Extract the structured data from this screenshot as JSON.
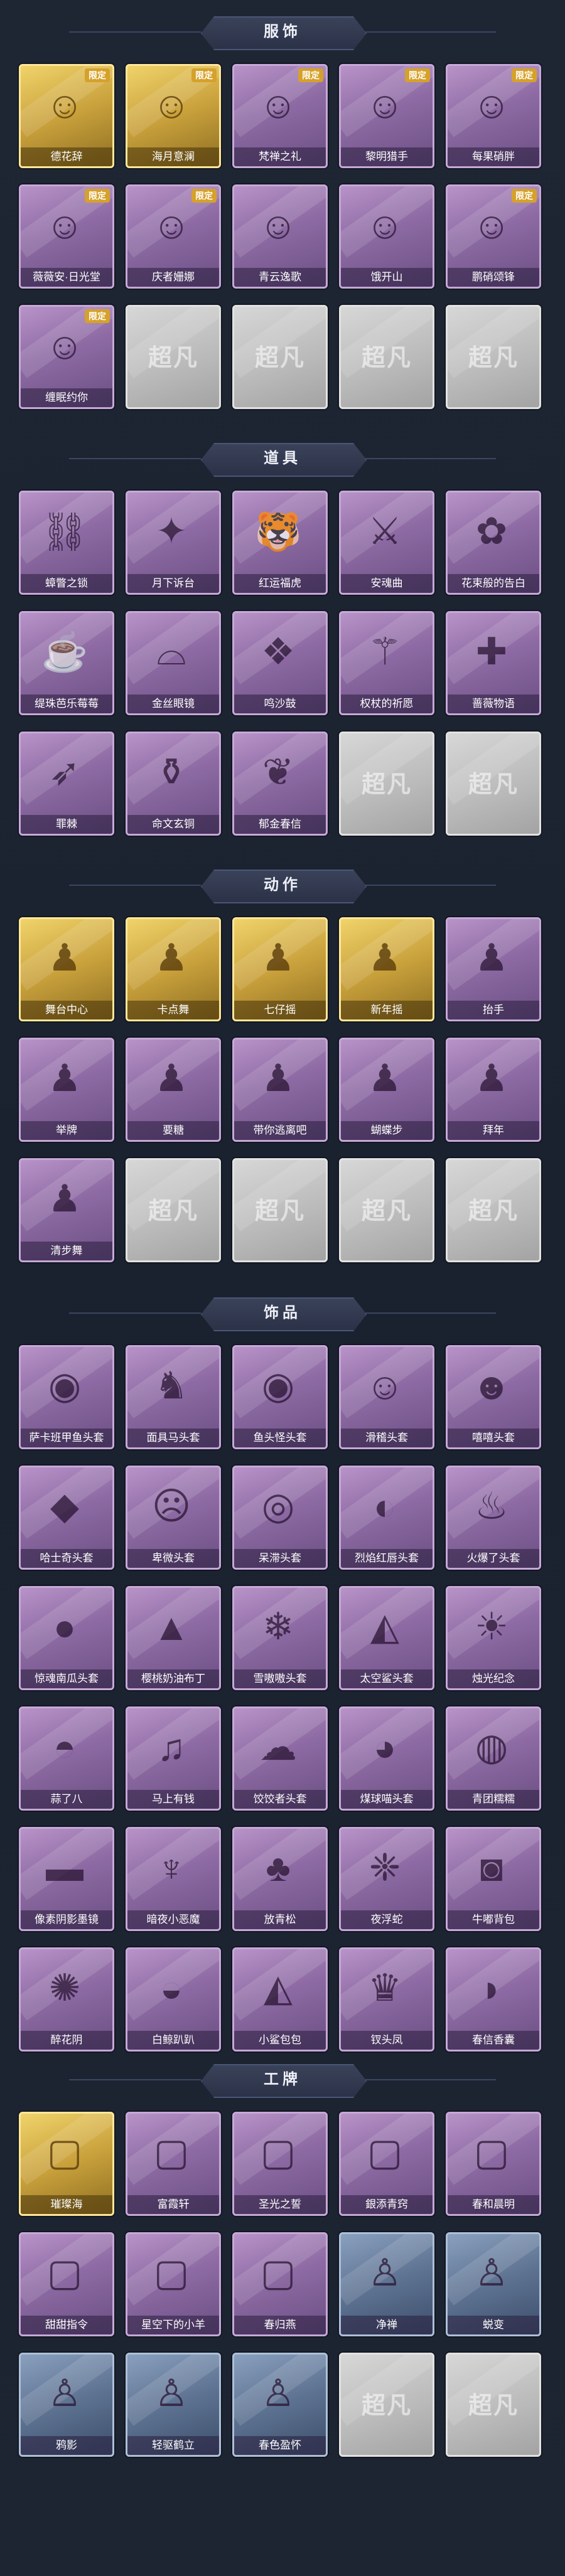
{
  "sections": [
    {
      "title": "服饰",
      "items": [
        {
          "name": "德花辞",
          "tone": "gold",
          "badge": "限定",
          "icon": "person-icon"
        },
        {
          "name": "海月意澜",
          "tone": "gold",
          "badge": "限定",
          "icon": "person-icon"
        },
        {
          "name": "梵禅之礼",
          "tone": "purple",
          "badge": "限定",
          "icon": "person-icon"
        },
        {
          "name": "黎明猎手",
          "tone": "purple",
          "badge": "限定",
          "icon": "person-icon"
        },
        {
          "name": "每果硝胖",
          "tone": "purple",
          "badge": "限定",
          "icon": "person-icon"
        },
        {
          "name": "薇薇安·日光堂",
          "tone": "purple",
          "badge": "限定",
          "icon": "person-icon"
        },
        {
          "name": "庆者姗娜",
          "tone": "purple",
          "badge": "限定",
          "icon": "person-icon"
        },
        {
          "name": "青云逸歌",
          "tone": "purple",
          "badge": "",
          "icon": "person-icon"
        },
        {
          "name": "饿开山",
          "tone": "purple",
          "badge": "",
          "icon": "person-icon"
        },
        {
          "name": "鹏硝颂锋",
          "tone": "purple",
          "badge": "限定",
          "icon": "person-icon"
        },
        {
          "name": "缠眠约你",
          "tone": "purple",
          "badge": "限定",
          "icon": "person-icon"
        },
        {
          "name": "",
          "tone": "empty",
          "badge": "",
          "icon": ""
        },
        {
          "name": "",
          "tone": "empty",
          "badge": "",
          "icon": ""
        },
        {
          "name": "",
          "tone": "empty",
          "badge": "",
          "icon": ""
        },
        {
          "name": "",
          "tone": "empty",
          "badge": "",
          "icon": ""
        }
      ]
    },
    {
      "title": "道具",
      "items": [
        {
          "name": "蟑瞥之锁",
          "tone": "purple",
          "badge": "",
          "icon": "chain-icon"
        },
        {
          "name": "月下诉台",
          "tone": "purple",
          "badge": "",
          "icon": "wand-icon"
        },
        {
          "name": "红运福虎",
          "tone": "purple",
          "badge": "",
          "icon": "tiger-icon"
        },
        {
          "name": "安魂曲",
          "tone": "purple",
          "badge": "",
          "icon": "sword-icon"
        },
        {
          "name": "花束般的告白",
          "tone": "purple",
          "badge": "",
          "icon": "rose-icon"
        },
        {
          "name": "缇珠芭乐莓莓",
          "tone": "purple",
          "badge": "",
          "icon": "drink-icon"
        },
        {
          "name": "金丝眼镜",
          "tone": "purple",
          "badge": "",
          "icon": "glasses-icon"
        },
        {
          "name": "鸣沙鼓",
          "tone": "purple",
          "badge": "",
          "icon": "lantern-icon"
        },
        {
          "name": "权杖的祈愿",
          "tone": "purple",
          "badge": "",
          "icon": "scepter-icon"
        },
        {
          "name": "蔷薇物语",
          "tone": "purple",
          "badge": "",
          "icon": "medkit-icon"
        },
        {
          "name": "罪棘",
          "tone": "purple",
          "badge": "",
          "icon": "spear-icon"
        },
        {
          "name": "命文玄铜",
          "tone": "purple",
          "badge": "",
          "icon": "bottle-icon"
        },
        {
          "name": "郁金春信",
          "tone": "purple",
          "badge": "",
          "icon": "scroll-icon"
        },
        {
          "name": "",
          "tone": "empty",
          "badge": "",
          "icon": ""
        },
        {
          "name": "",
          "tone": "empty",
          "badge": "",
          "icon": ""
        }
      ]
    },
    {
      "title": "动作",
      "items": [
        {
          "name": "舞台中心",
          "tone": "gold",
          "badge": "",
          "icon": "pose-icon"
        },
        {
          "name": "卡点舞",
          "tone": "gold",
          "badge": "",
          "icon": "pose-icon"
        },
        {
          "name": "七仔摇",
          "tone": "gold",
          "badge": "",
          "icon": "pose-icon"
        },
        {
          "name": "新年摇",
          "tone": "gold",
          "badge": "",
          "icon": "pose-icon"
        },
        {
          "name": "抬手",
          "tone": "purple",
          "badge": "",
          "icon": "pose-icon"
        },
        {
          "name": "举牌",
          "tone": "purple",
          "badge": "",
          "icon": "pose-icon"
        },
        {
          "name": "要糖",
          "tone": "purple",
          "badge": "",
          "icon": "pose-icon"
        },
        {
          "name": "带你逃离吧",
          "tone": "purple",
          "badge": "",
          "icon": "pose-icon"
        },
        {
          "name": "蝴蝶步",
          "tone": "purple",
          "badge": "",
          "icon": "pose-icon"
        },
        {
          "name": "拜年",
          "tone": "purple",
          "badge": "",
          "icon": "pose-icon"
        },
        {
          "name": "清步舞",
          "tone": "purple",
          "badge": "",
          "icon": "pose-icon"
        },
        {
          "name": "",
          "tone": "empty",
          "badge": "",
          "icon": ""
        },
        {
          "name": "",
          "tone": "empty",
          "badge": "",
          "icon": ""
        },
        {
          "name": "",
          "tone": "empty",
          "badge": "",
          "icon": ""
        },
        {
          "name": "",
          "tone": "empty",
          "badge": "",
          "icon": ""
        }
      ]
    },
    {
      "title": "饰品",
      "items": [
        {
          "name": "萨卡班甲鱼头套",
          "tone": "purple",
          "badge": "",
          "icon": "fish-icon"
        },
        {
          "name": "面具马头套",
          "tone": "purple",
          "badge": "",
          "icon": "horse-icon"
        },
        {
          "name": "鱼头怪头套",
          "tone": "purple",
          "badge": "",
          "icon": "fish-icon"
        },
        {
          "name": "滑稽头套",
          "tone": "purple",
          "badge": "",
          "icon": "smile-icon"
        },
        {
          "name": "嘻嘻头套",
          "tone": "purple",
          "badge": "",
          "icon": "grin-icon"
        },
        {
          "name": "哈士奇头套",
          "tone": "purple",
          "badge": "",
          "icon": "dog-icon"
        },
        {
          "name": "卑微头套",
          "tone": "purple",
          "badge": "",
          "icon": "sad-icon"
        },
        {
          "name": "呆滞头套",
          "tone": "purple",
          "badge": "",
          "icon": "stare-icon"
        },
        {
          "name": "烈焰红唇头套",
          "tone": "purple",
          "badge": "",
          "icon": "cool-icon"
        },
        {
          "name": "火爆了头套",
          "tone": "purple",
          "badge": "",
          "icon": "fire-icon"
        },
        {
          "name": "惊魂南瓜头套",
          "tone": "purple",
          "badge": "",
          "icon": "pumpkin-icon"
        },
        {
          "name": "樱桃奶油布丁",
          "tone": "purple",
          "badge": "",
          "icon": "pudding-icon"
        },
        {
          "name": "雪嗷嗷头套",
          "tone": "purple",
          "badge": "",
          "icon": "snow-icon"
        },
        {
          "name": "太空鲨头套",
          "tone": "purple",
          "badge": "",
          "icon": "shark-icon"
        },
        {
          "name": "烛光纪念",
          "tone": "purple",
          "badge": "",
          "icon": "candle-icon"
        },
        {
          "name": "蒜了八",
          "tone": "purple",
          "badge": "",
          "icon": "garlic-icon"
        },
        {
          "name": "马上有钱",
          "tone": "purple",
          "badge": "",
          "icon": "bird-icon"
        },
        {
          "name": "饺饺者头套",
          "tone": "purple",
          "badge": "",
          "icon": "cloud-icon"
        },
        {
          "name": "煤球喵头套",
          "tone": "purple",
          "badge": "",
          "icon": "cat-icon"
        },
        {
          "name": "青团糯糯",
          "tone": "purple",
          "badge": "",
          "icon": "dumpling-icon"
        },
        {
          "name": "像素阴影墨镜",
          "tone": "purple",
          "badge": "",
          "icon": "sunglasses-icon"
        },
        {
          "name": "暗夜小恶魔",
          "tone": "purple",
          "badge": "",
          "icon": "devil-icon"
        },
        {
          "name": "放青松",
          "tone": "purple",
          "badge": "",
          "icon": "tree-icon"
        },
        {
          "name": "夜浮蛇",
          "tone": "purple",
          "badge": "",
          "icon": "crystal-icon"
        },
        {
          "name": "牛嘟背包",
          "tone": "purple",
          "badge": "",
          "icon": "cow-icon"
        },
        {
          "name": "醉花阴",
          "tone": "purple",
          "badge": "",
          "icon": "hairpin-icon"
        },
        {
          "name": "白鲸趴趴",
          "tone": "purple",
          "badge": "",
          "icon": "whale-icon"
        },
        {
          "name": "小鲨包包",
          "tone": "purple",
          "badge": "",
          "icon": "shark-icon"
        },
        {
          "name": "钗头凤",
          "tone": "purple",
          "badge": "",
          "icon": "crown-icon"
        },
        {
          "name": "春信香囊",
          "tone": "purple",
          "badge": "",
          "icon": "pouch-icon"
        }
      ]
    },
    {
      "title": "工牌",
      "items": [
        {
          "name": "璀璨海",
          "tone": "gold",
          "badge": "",
          "icon": "frame-icon"
        },
        {
          "name": "富霞轩",
          "tone": "purple",
          "badge": "",
          "icon": "frame-icon"
        },
        {
          "name": "圣光之誓",
          "tone": "purple",
          "badge": "",
          "icon": "frame-icon"
        },
        {
          "name": "銀添青窍",
          "tone": "purple",
          "badge": "",
          "icon": "frame-icon"
        },
        {
          "name": "春和晨明",
          "tone": "purple",
          "badge": "",
          "icon": "frame-icon"
        },
        {
          "name": "甜甜指令",
          "tone": "purple",
          "badge": "",
          "icon": "frame-icon"
        },
        {
          "name": "星空下的小羊",
          "tone": "purple",
          "badge": "",
          "icon": "frame-icon"
        },
        {
          "name": "春归燕",
          "tone": "purple",
          "badge": "",
          "icon": "frame-icon"
        },
        {
          "name": "净禅",
          "tone": "blue",
          "badge": "",
          "icon": "silhouette-icon"
        },
        {
          "name": "蜕变",
          "tone": "blue",
          "badge": "",
          "icon": "silhouette-icon"
        },
        {
          "name": "鸦影",
          "tone": "blue",
          "badge": "",
          "icon": "silhouette-icon"
        },
        {
          "name": "轻驱鹤立",
          "tone": "blue",
          "badge": "",
          "icon": "silhouette-icon"
        },
        {
          "name": "春色盈怀",
          "tone": "blue",
          "badge": "",
          "icon": "silhouette-icon"
        },
        {
          "name": "",
          "tone": "empty",
          "badge": "",
          "icon": ""
        },
        {
          "name": "",
          "tone": "empty",
          "badge": "",
          "icon": ""
        }
      ]
    }
  ],
  "empty_watermark": "超凡",
  "colors": {
    "background": "#1d2431",
    "gold": "#c9a13c",
    "purple": "#8d6aa3",
    "blue": "#5d7291"
  }
}
